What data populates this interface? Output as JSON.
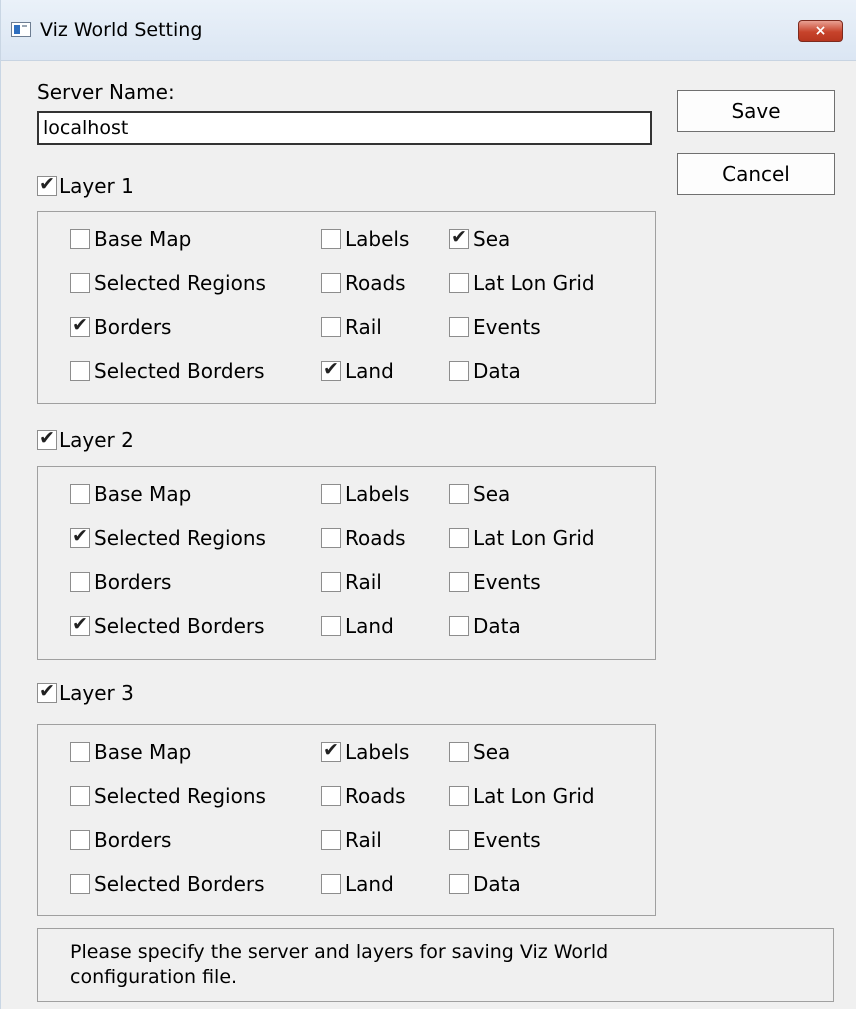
{
  "window": {
    "title": "Viz World Setting",
    "close_glyph": "×",
    "icon": "app-window-icon"
  },
  "server": {
    "label": "Server Name:",
    "value": "localhost"
  },
  "buttons": {
    "save": "Save",
    "cancel": "Cancel"
  },
  "layers": [
    {
      "label": "Layer 1",
      "checked": true,
      "options": [
        {
          "label": "Base Map",
          "checked": false
        },
        {
          "label": "Labels",
          "checked": false
        },
        {
          "label": "Sea",
          "checked": true
        },
        {
          "label": "Selected Regions",
          "checked": false
        },
        {
          "label": "Roads",
          "checked": false
        },
        {
          "label": "Lat Lon Grid",
          "checked": false
        },
        {
          "label": "Borders",
          "checked": true
        },
        {
          "label": "Rail",
          "checked": false
        },
        {
          "label": "Events",
          "checked": false
        },
        {
          "label": "Selected Borders",
          "checked": false
        },
        {
          "label": "Land",
          "checked": true
        },
        {
          "label": "Data",
          "checked": false
        }
      ]
    },
    {
      "label": "Layer 2",
      "checked": true,
      "options": [
        {
          "label": "Base Map",
          "checked": false
        },
        {
          "label": "Labels",
          "checked": false
        },
        {
          "label": "Sea",
          "checked": false
        },
        {
          "label": "Selected Regions",
          "checked": true
        },
        {
          "label": "Roads",
          "checked": false
        },
        {
          "label": "Lat Lon Grid",
          "checked": false
        },
        {
          "label": "Borders",
          "checked": false
        },
        {
          "label": "Rail",
          "checked": false
        },
        {
          "label": "Events",
          "checked": false
        },
        {
          "label": "Selected Borders",
          "checked": true
        },
        {
          "label": "Land",
          "checked": false
        },
        {
          "label": "Data",
          "checked": false
        }
      ]
    },
    {
      "label": "Layer 3",
      "checked": true,
      "options": [
        {
          "label": "Base Map",
          "checked": false
        },
        {
          "label": "Labels",
          "checked": true
        },
        {
          "label": "Sea",
          "checked": false
        },
        {
          "label": "Selected Regions",
          "checked": false
        },
        {
          "label": "Roads",
          "checked": false
        },
        {
          "label": "Lat Lon Grid",
          "checked": false
        },
        {
          "label": "Borders",
          "checked": false
        },
        {
          "label": "Rail",
          "checked": false
        },
        {
          "label": "Events",
          "checked": false
        },
        {
          "label": "Selected Borders",
          "checked": false
        },
        {
          "label": "Land",
          "checked": false
        },
        {
          "label": "Data",
          "checked": false
        }
      ]
    }
  ],
  "status_text": "Please specify the server and layers for saving Viz World configuration file."
}
